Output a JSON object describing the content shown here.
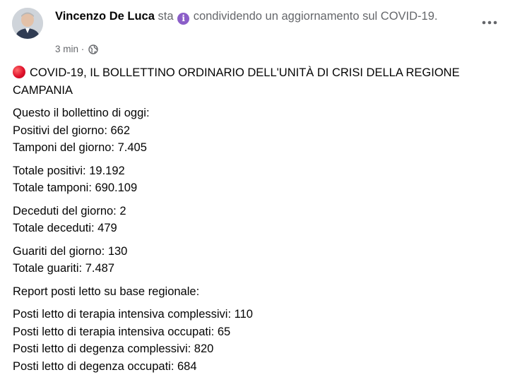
{
  "header": {
    "author": "Vincenzo De Luca",
    "verb": "sta",
    "activity": "condividendo un aggiornamento sul COVID-19.",
    "info_icon_glyph": "i",
    "time": "3 min",
    "separator": "·",
    "privacy_icon": "globe-icon",
    "more_icon": "more-options-icon"
  },
  "post": {
    "title": "COVID-19, IL BOLLETTINO ORDINARIO DELL'UNITÀ DI CRISI DELLA REGIONE CAMPANIA",
    "title_icon": "red-circle-icon",
    "paragraphs": [
      [
        "Questo il bollettino di oggi:",
        "Positivi del giorno: 662",
        "Tamponi del giorno: 7.405"
      ],
      [
        "Totale positivi: 19.192",
        "Totale tamponi: 690.109"
      ],
      [
        "Deceduti del giorno: 2",
        "Totale deceduti: 479"
      ],
      [
        "Guariti del giorno: 130",
        "Totale guariti: 7.487"
      ],
      [
        "Report posti letto su base regionale:"
      ],
      [
        "Posti letto di terapia intensiva complessivi: 110",
        "Posti letto di terapia intensiva occupati: 65",
        "Posti letto di degenza complessivi: 820",
        "Posti letto di degenza occupati: 684"
      ]
    ]
  },
  "colors": {
    "text": "#050505",
    "muted": "#65676b",
    "info_icon_bg": "#8b5ec8",
    "red_dot": "#e0112b"
  }
}
